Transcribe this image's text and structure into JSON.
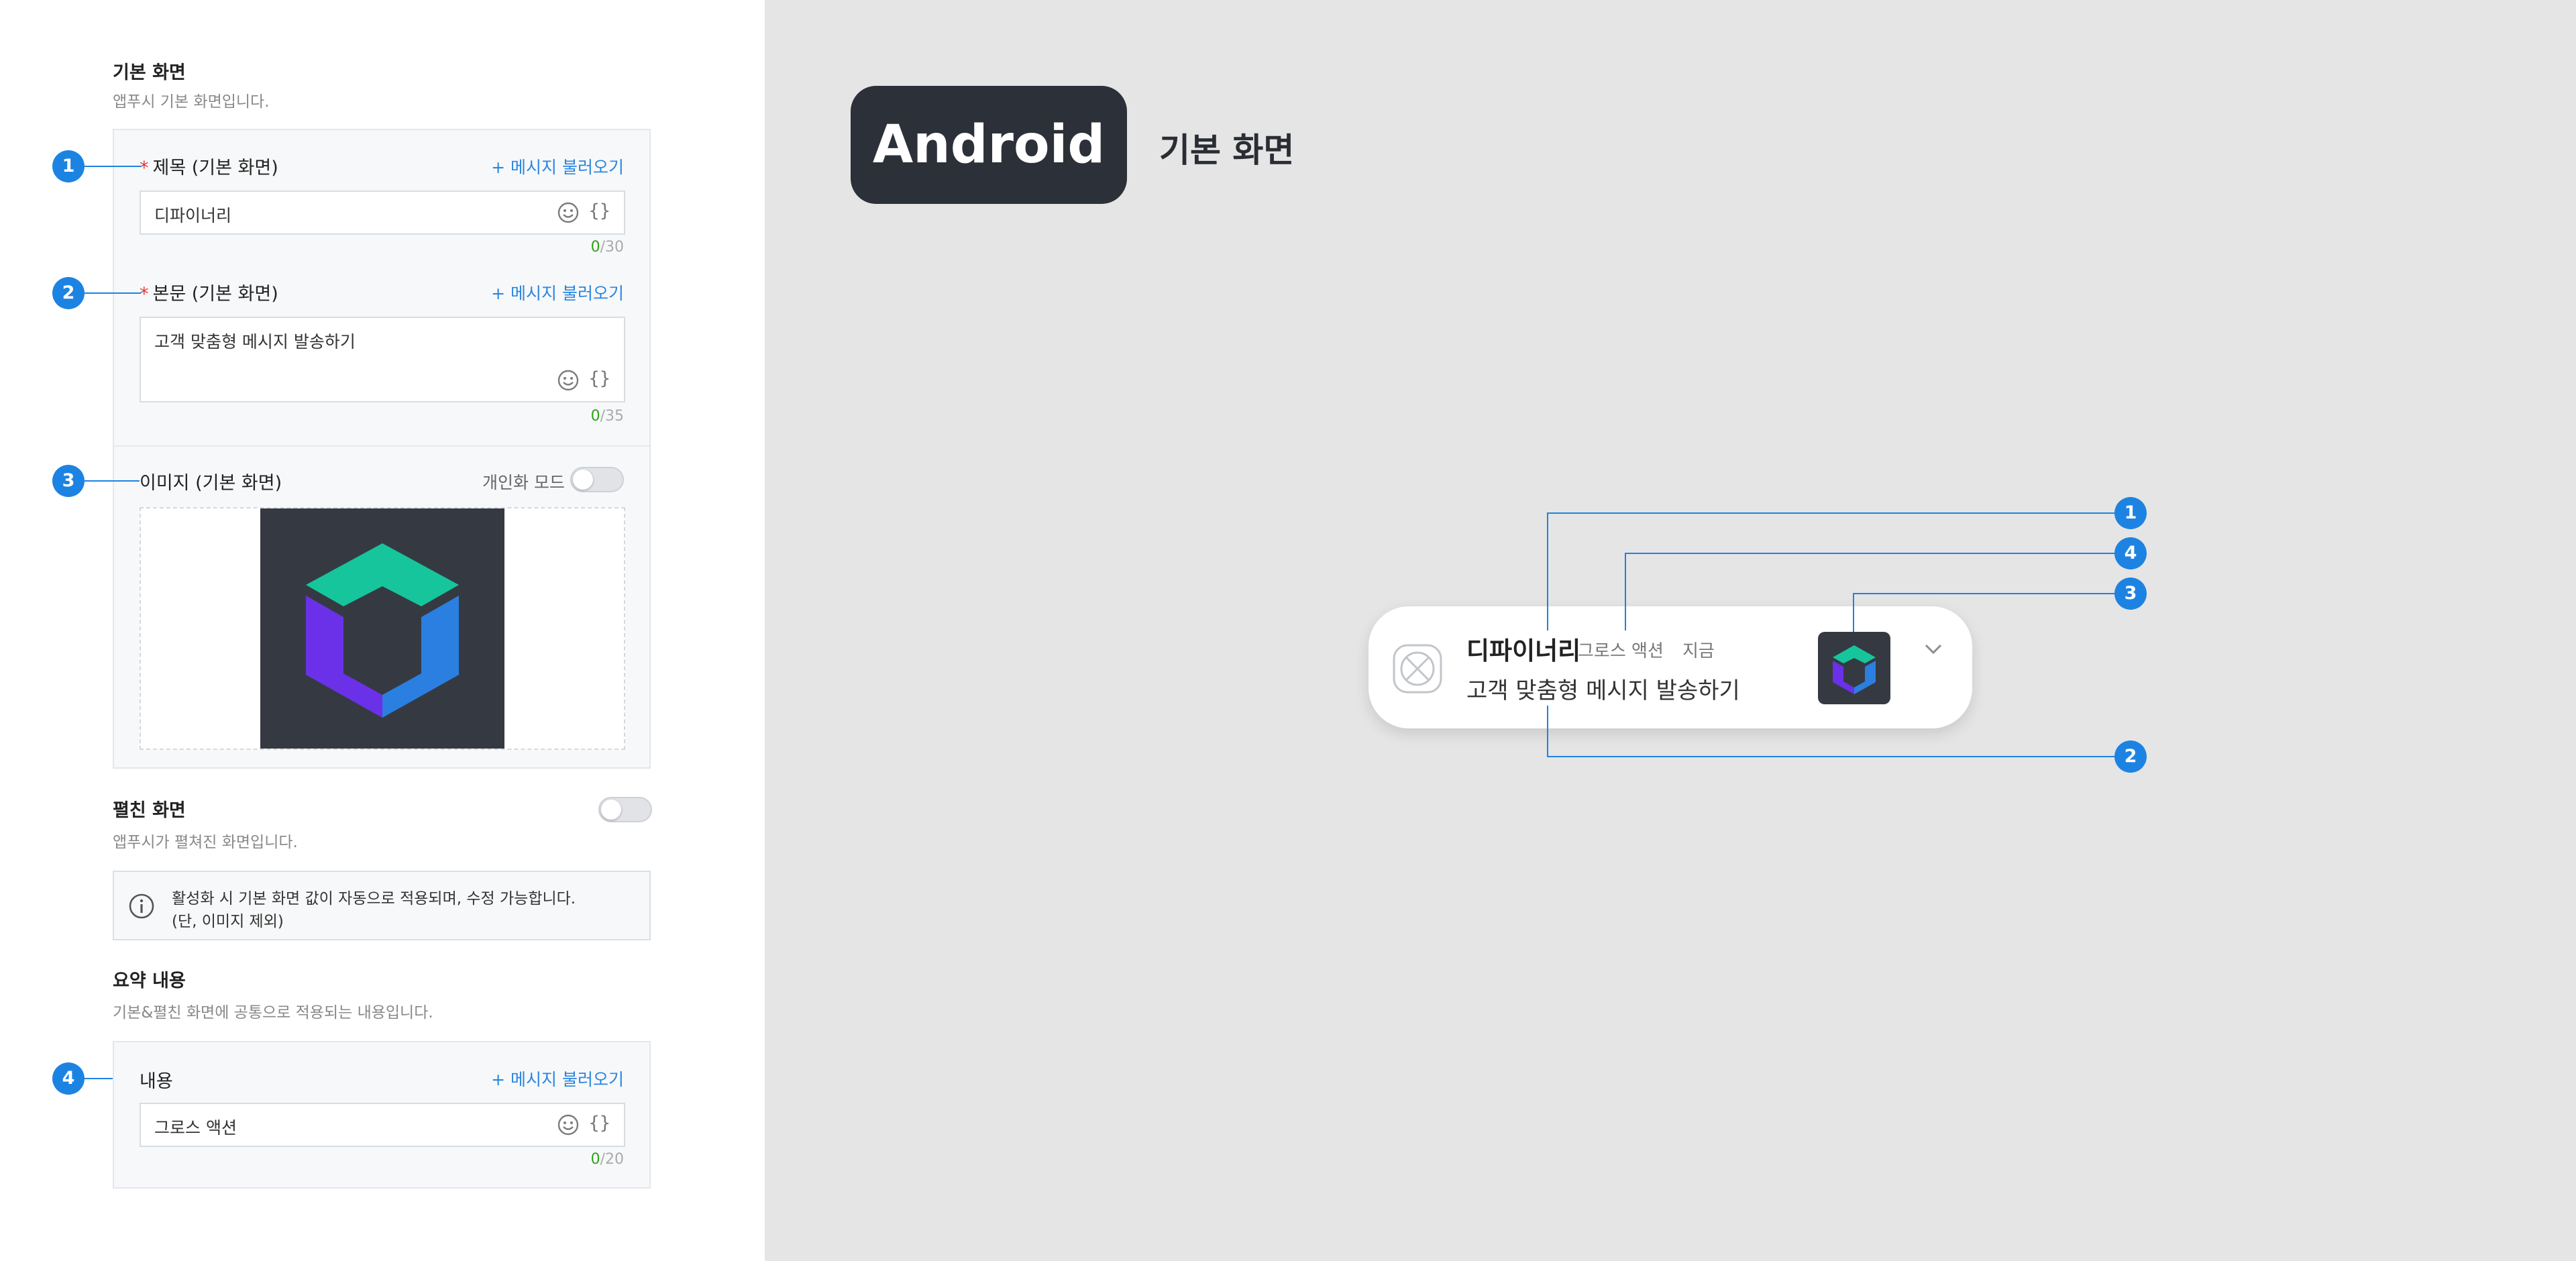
{
  "basic_screen": {
    "title": "기본 화면",
    "desc": "앱푸시 기본 화면입니다.",
    "title_field": {
      "label": "제목 (기본 화면)",
      "load_button": "+ 메시지 불러오기",
      "value": "디파이너리",
      "count_current": "0",
      "count_max": "/30"
    },
    "body_field": {
      "label": "본문 (기본 화면)",
      "load_button": "+ 메시지 불러오기",
      "value": "고객 맞춤형 메시지 발송하기",
      "count_current": "0",
      "count_max": "/35"
    },
    "image_field": {
      "label": "이미지 (기본 화면)",
      "personalize_label": "개인화 모드"
    }
  },
  "expanded_screen": {
    "title": "펼친 화면",
    "desc": "앱푸시가 펼쳐진 화면입니다.",
    "info_line1": "활성화 시 기본 화면 값이 자동으로 적용되며, 수정 가능합니다.",
    "info_line2": "(단, 이미지 제외)"
  },
  "summary": {
    "title": "요약 내용",
    "desc": "기본&펼친 화면에 공통으로 적용되는 내용입니다.",
    "content_field": {
      "label": "내용",
      "load_button": "+ 메시지 불러오기",
      "value": "그로스 액션",
      "count_current": "0",
      "count_max": "/20"
    }
  },
  "brace_glyph": "{}",
  "markers": [
    "1",
    "2",
    "3",
    "4"
  ],
  "preview": {
    "platform_badge": "Android",
    "screen_label": "기본 화면",
    "notification": {
      "app_title": "디파이너리",
      "sender": "그로스 액션",
      "time": "지금",
      "body": "고객 맞춤형 메시지 발송하기"
    },
    "callouts": [
      "1",
      "4",
      "3",
      "2"
    ]
  },
  "colors": {
    "accent": "#1d83e2",
    "link": "#2a86e0",
    "required": "#e53935",
    "counter_ok": "#2fa31c",
    "dark": "#2c3038",
    "teal": "#16c59b",
    "purple": "#6a31e8",
    "blue": "#2a7fe0"
  },
  "icons": [
    "smile-icon",
    "variable-icon",
    "info-icon",
    "chevron-down-icon",
    "broken-image-icon",
    "logo-icon"
  ]
}
